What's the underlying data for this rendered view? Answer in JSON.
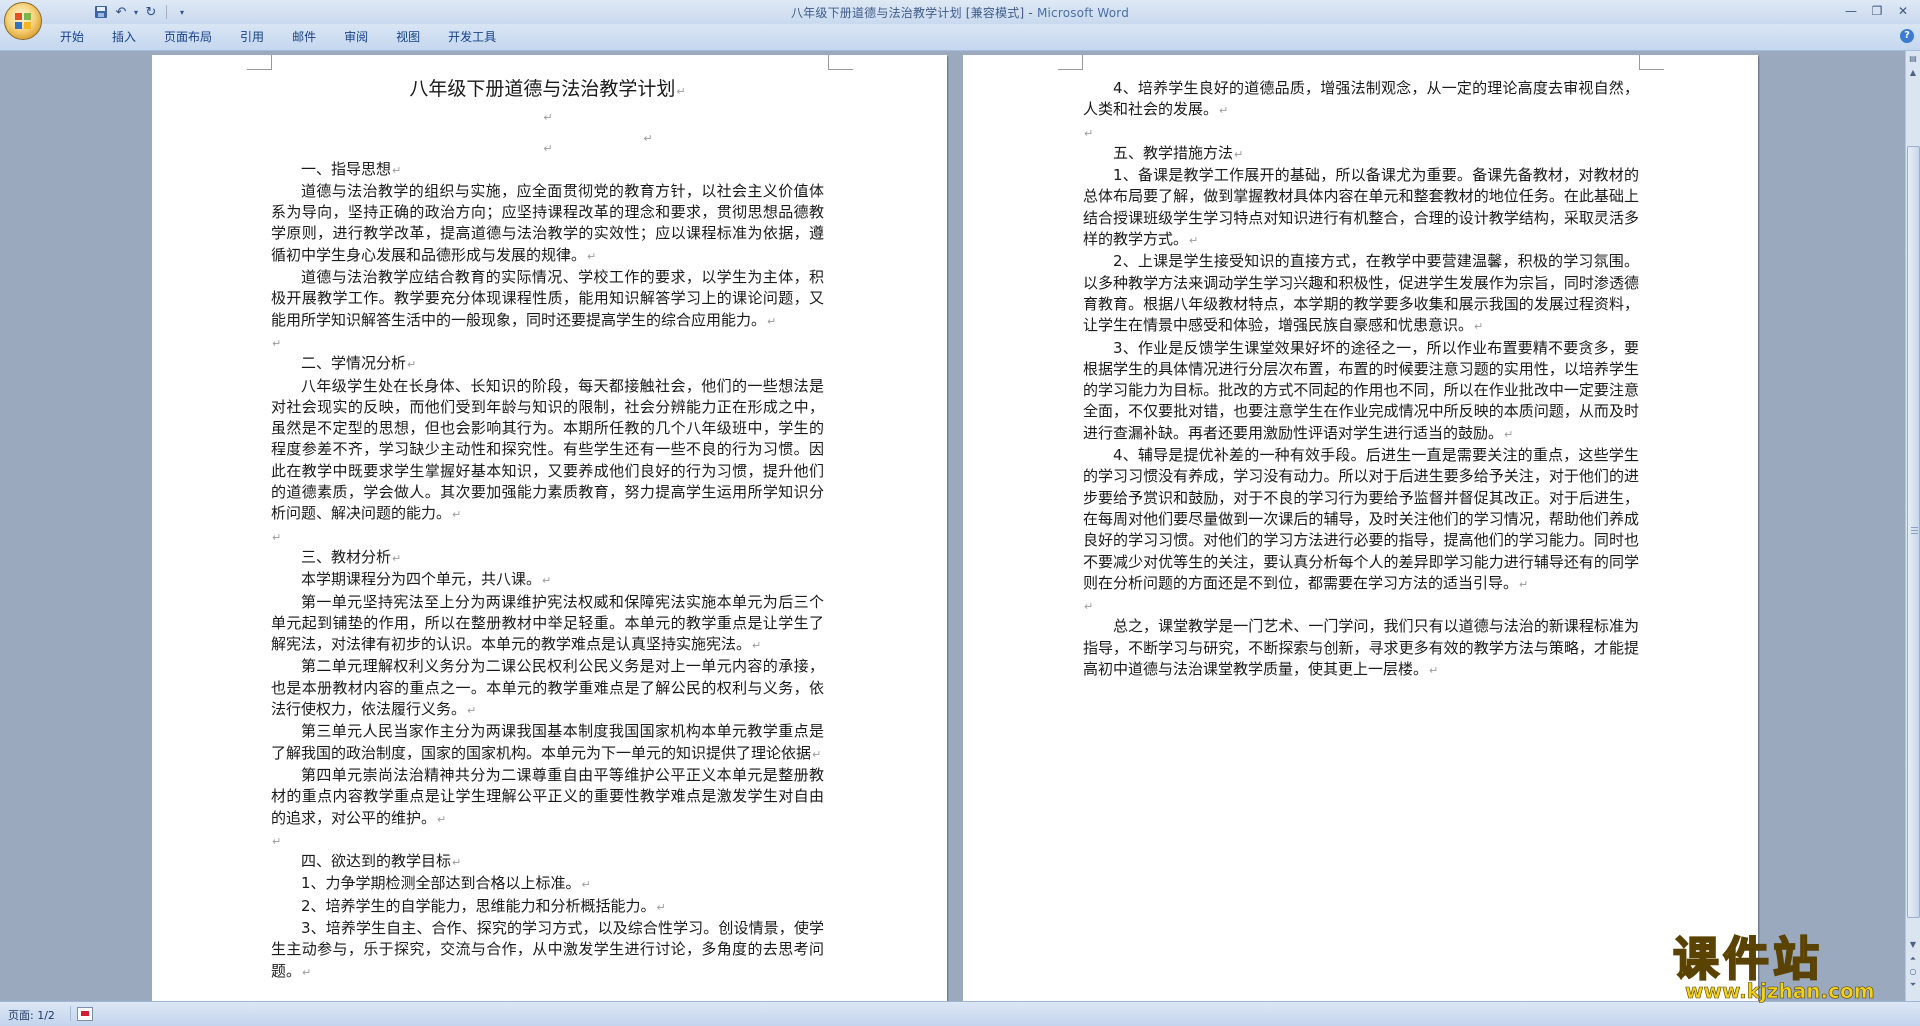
{
  "window": {
    "title_doc": "八年级下册道德与法治教学计划 [兼容模式]",
    "title_sep": " - ",
    "title_app": "Microsoft Word"
  },
  "ribbon": {
    "tabs": [
      "开始",
      "插入",
      "页面布局",
      "引用",
      "邮件",
      "审阅",
      "视图",
      "开发工具"
    ]
  },
  "status": {
    "page": "页面: 1/2"
  },
  "watermark": {
    "title": "课件站",
    "url": "www.kjzhan.com"
  },
  "document": {
    "title": "八年级下册道德与法治教学计划",
    "page1": [
      "一、指导思想",
      "道德与法治教学的组织与实施，应全面贯彻党的教育方针，以社会主义价值体系为导向，坚持正确的政治方向；应坚持课程改革的理念和要求，贯彻思想品德教学原则，进行教学改革，提高道德与法治教学的实效性；应以课程标准为依据，遵循初中学生身心发展和品德形成与发展的规律。",
      "道德与法治教学应结合教育的实际情况、学校工作的要求，以学生为主体，积极开展教学工作。教学要充分体现课程性质，能用知识解答学习上的课论问题，又能用所学知识解答生活中的一般现象，同时还要提高学生的综合应用能力。",
      "",
      "二、学情况分析",
      "八年级学生处在长身体、长知识的阶段，每天都接触社会，他们的一些想法是对社会现实的反映，而他们受到年龄与知识的限制，社会分辨能力正在形成之中，虽然是不定型的思想，但也会影响其行为。本期所任教的几个八年级班中，学生的程度参差不齐，学习缺少主动性和探究性。有些学生还有一些不良的行为习惯。因此在教学中既要求学生掌握好基本知识，又要养成他们良好的行为习惯，提升他们的道德素质，学会做人。其次要加强能力素质教育，努力提高学生运用所学知识分析问题、解决问题的能力。",
      "",
      "三、教材分析",
      "本学期课程分为四个单元，共八课。",
      "第一单元坚持宪法至上分为两课维护宪法权威和保障宪法实施本单元为后三个单元起到铺垫的作用，所以在整册教材中举足轻重。本单元的教学重点是让学生了解宪法，对法律有初步的认识。本单元的教学难点是认真坚持实施宪法。",
      "第二单元理解权利义务分为二课公民权利公民义务是对上一单元内容的承接，也是本册教材内容的重点之一。本单元的教学重难点是了解公民的权利与义务，依法行使权力，依法履行义务。",
      "第三单元人民当家作主分为两课我国基本制度我国国家机构本单元教学重点是了解我国的政治制度，国家的国家机构。本单元为下一单元的知识提供了理论依据",
      "第四单元崇尚法治精神共分为二课尊重自由平等维护公平正义本单元是整册教材的重点内容教学重点是让学生理解公平正义的重要性教学难点是激发学生对自由的追求，对公平的维护。",
      "",
      "四、欲达到的教学目标",
      "1、力争学期检测全部达到合格以上标准。",
      "2、培养学生的自学能力，思维能力和分析概括能力。",
      "3、培养学生自主、合作、探究的学习方式，以及综合性学习。创设情景，使学生主动参与，乐于探究，交流与合作，从中激发学生进行讨论，多角度的去思考问题。"
    ],
    "page2": [
      "4、培养学生良好的道德品质，增强法制观念，从一定的理论高度去审视自然，人类和社会的发展。",
      "",
      "五、教学措施方法",
      "1、备课是教学工作展开的基础，所以备课尤为重要。备课先备教材，对教材的总体布局要了解，做到掌握教材具体内容在单元和整套教材的地位任务。在此基础上结合授课班级学生学习特点对知识进行有机整合，合理的设计教学结构，采取灵活多样的教学方式。",
      "2、上课是学生接受知识的直接方式，在教学中要营建温馨，积极的学习氛围。以多种教学方法来调动学生学习兴趣和积极性，促进学生发展作为宗旨，同时渗透德育教育。根据八年级教材特点，本学期的教学要多收集和展示我国的发展过程资料，让学生在情景中感受和体验，增强民族自豪感和忧患意识。",
      "3、作业是反馈学生课堂效果好坏的途径之一，所以作业布置要精不要贪多，要根据学生的具体情况进行分层次布置，布置的时候要注意习题的实用性，以培养学生的学习能力为目标。批改的方式不同起的作用也不同，所以在作业批改中一定要注意全面，不仅要批对错，也要注意学生在作业完成情况中所反映的本质问题，从而及时进行查漏补缺。再者还要用激励性评语对学生进行适当的鼓励。",
      "4、辅导是提优补差的一种有效手段。后进生一直是需要关注的重点，这些学生的学习习惯没有养成，学习没有动力。所以对于后进生要多给予关注，对于他们的进步要给予赏识和鼓励，对于不良的学习行为要给予监督并督促其改正。对于后进生，在每周对他们要尽量做到一次课后的辅导，及时关注他们的学习情况，帮助他们养成良好的学习习惯。对他们的学习方法进行必要的指导，提高他们的学习能力。同时也不要减少对优等生的关注，要认真分析每个人的差异即学习能力进行辅导还有的同学则在分析问题的方面还是不到位，都需要在学习方法的适当引导。",
      "",
      "总之，课堂教学是一门艺术、一门学问，我们只有以道德与法治的新课程标准为指导，不断学习与研究，不断探索与创新，寻求更多有效的教学方法与策略，才能提高初中道德与法治课堂教学质量，使其更上一层楼。"
    ]
  }
}
